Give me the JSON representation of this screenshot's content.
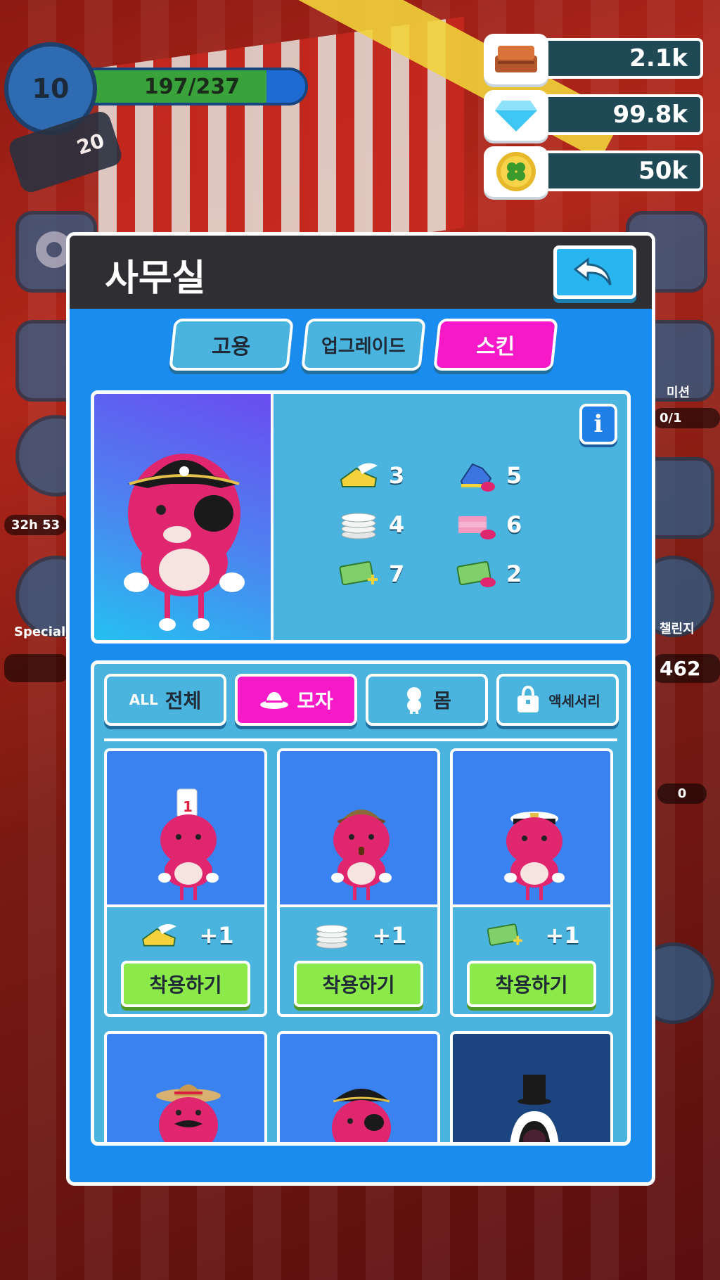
{
  "level": {
    "number": "10",
    "progress_text": "197/237",
    "progress_fraction": 0.83,
    "sub_badge": "20"
  },
  "currencies": [
    {
      "name": "bricks",
      "icon": "brick-stack-icon",
      "value": "2.1k"
    },
    {
      "name": "gems",
      "icon": "diamond-icon",
      "value": "99.8k"
    },
    {
      "name": "clover",
      "icon": "clover-coin-icon",
      "value": "50k"
    }
  ],
  "side_labels": {
    "left_timer": "32h 53",
    "left_special": "Special_",
    "right_mission": "미션",
    "right_count": "0/1",
    "right_challenge": "챌린지",
    "right_value": "462",
    "right_zero": "0"
  },
  "panel": {
    "title": "사무실",
    "back_icon": "undo-arrow-icon",
    "tabs": [
      {
        "label": "고용",
        "active": false
      },
      {
        "label": "업그레이드",
        "active": false
      },
      {
        "label": "스킨",
        "active": true
      }
    ],
    "info_label": "i",
    "stats": [
      {
        "icon": "winged-shoe-icon",
        "value": "3"
      },
      {
        "icon": "skate-heart-icon",
        "value": "5"
      },
      {
        "icon": "plate-stack-icon",
        "value": "4"
      },
      {
        "icon": "pink-plates-heart-icon",
        "value": "6"
      },
      {
        "icon": "cash-plus-icon",
        "value": "7"
      },
      {
        "icon": "cash-heart-icon",
        "value": "2"
      }
    ],
    "filters": [
      {
        "prefix": "ALL",
        "label": "전체",
        "icon": "",
        "active": false
      },
      {
        "prefix": "",
        "label": "모자",
        "icon": "hat-icon",
        "active": true
      },
      {
        "prefix": "",
        "label": "몸",
        "icon": "body-icon",
        "active": false
      },
      {
        "prefix": "",
        "label": "액세서리",
        "icon": "bag-icon",
        "active": false
      }
    ],
    "items": [
      {
        "hat": "chef-hat-1",
        "reward_icon": "winged-shoe-icon",
        "reward": "+1",
        "button": "착용하기"
      },
      {
        "hat": "detective-hat",
        "reward_icon": "plate-stack-icon",
        "reward": "+1",
        "button": "착용하기"
      },
      {
        "hat": "captain-hat",
        "reward_icon": "cash-plus-icon",
        "reward": "+1",
        "button": "착용하기"
      },
      {
        "hat": "sombrero",
        "reward_icon": "",
        "reward": "",
        "button": ""
      },
      {
        "hat": "pirate-hat",
        "reward_icon": "",
        "reward": "",
        "button": ""
      },
      {
        "hat": "top-hat",
        "reward_icon": "",
        "reward": "",
        "button": ""
      }
    ]
  }
}
